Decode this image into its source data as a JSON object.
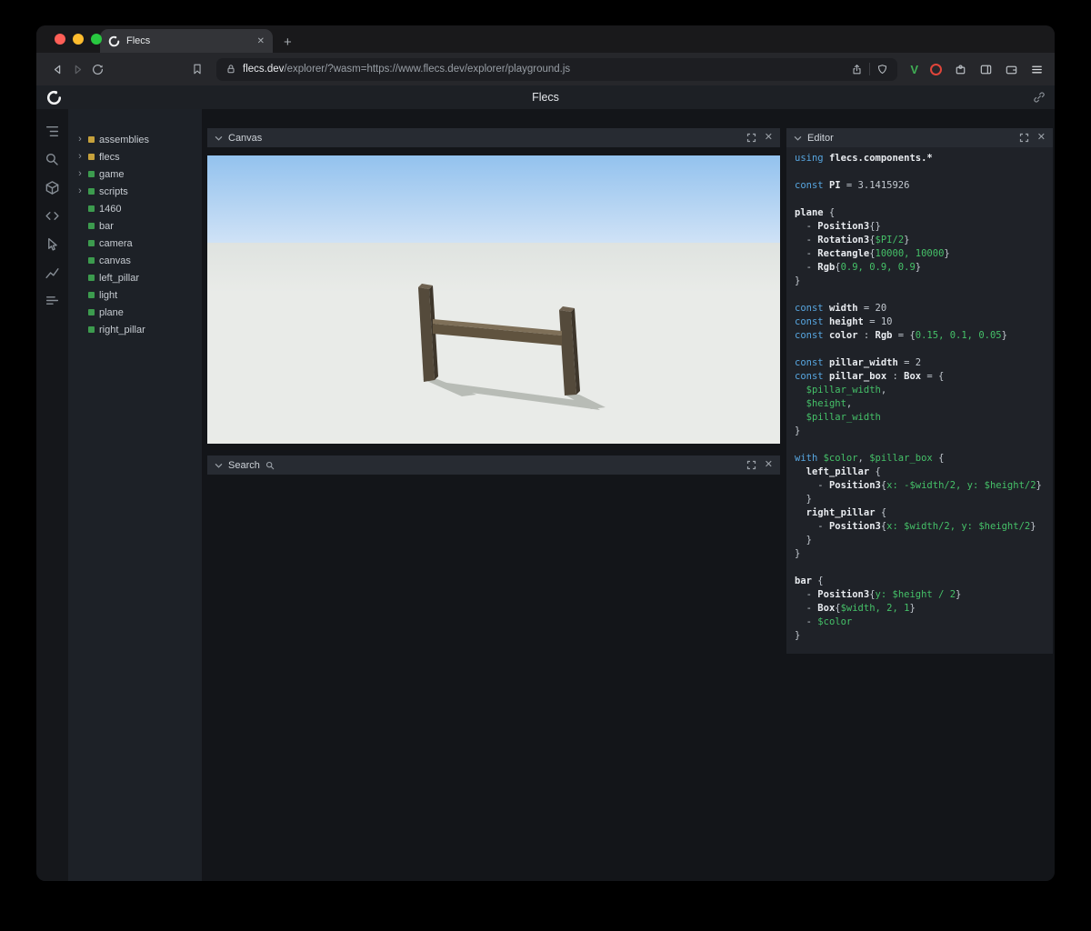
{
  "glyphs": {
    "close": "✕",
    "plus": "+",
    "expander": "›"
  },
  "browser": {
    "tab_title": "Flecs",
    "url_domain": "flecs.dev",
    "url_path": "/explorer/?wasm=https://www.flecs.dev/explorer/playground.js"
  },
  "header": {
    "title": "Flecs"
  },
  "rail_icons": [
    "tree-icon",
    "search-icon",
    "cube-icon",
    "code-icon",
    "inspect-icon",
    "chart-icon",
    "stats-icon"
  ],
  "tree": {
    "items": [
      {
        "label": "assemblies",
        "color": "#c6a13c",
        "expandable": true
      },
      {
        "label": "flecs",
        "color": "#c6a13c",
        "expandable": true
      },
      {
        "label": "game",
        "color": "#3c9b4e",
        "expandable": true
      },
      {
        "label": "scripts",
        "color": "#3c9b4e",
        "expandable": true
      },
      {
        "label": "1460",
        "color": "#3c9b4e",
        "expandable": false
      },
      {
        "label": "bar",
        "color": "#3c9b4e",
        "expandable": false
      },
      {
        "label": "camera",
        "color": "#3c9b4e",
        "expandable": false
      },
      {
        "label": "canvas",
        "color": "#3c9b4e",
        "expandable": false
      },
      {
        "label": "left_pillar",
        "color": "#3c9b4e",
        "expandable": false
      },
      {
        "label": "light",
        "color": "#3c9b4e",
        "expandable": false
      },
      {
        "label": "plane",
        "color": "#3c9b4e",
        "expandable": false
      },
      {
        "label": "right_pillar",
        "color": "#3c9b4e",
        "expandable": false
      }
    ]
  },
  "panels": {
    "canvas": {
      "title": "Canvas"
    },
    "search": {
      "title": "Search"
    },
    "editor": {
      "title": "Editor"
    }
  },
  "editor_code": {
    "lines": [
      [
        {
          "t": "using ",
          "c": "kw"
        },
        {
          "t": "flecs.components.*",
          "c": "id"
        }
      ],
      [],
      [
        {
          "t": "const ",
          "c": "kw"
        },
        {
          "t": "PI",
          "c": "id"
        },
        {
          "t": " = 3.1415926",
          "c": "pl"
        }
      ],
      [],
      [
        {
          "t": "plane",
          "c": "id"
        },
        {
          "t": " {",
          "c": "pl"
        }
      ],
      [
        {
          "t": "  - ",
          "c": "pl"
        },
        {
          "t": "Position3",
          "c": "id"
        },
        {
          "t": "{}",
          "c": "pl"
        }
      ],
      [
        {
          "t": "  - ",
          "c": "pl"
        },
        {
          "t": "Rotation3",
          "c": "id"
        },
        {
          "t": "{",
          "c": "pl"
        },
        {
          "t": "$PI/2",
          "c": "gr"
        },
        {
          "t": "}",
          "c": "pl"
        }
      ],
      [
        {
          "t": "  - ",
          "c": "pl"
        },
        {
          "t": "Rectangle",
          "c": "id"
        },
        {
          "t": "{",
          "c": "pl"
        },
        {
          "t": "10000, 10000",
          "c": "gr"
        },
        {
          "t": "}",
          "c": "pl"
        }
      ],
      [
        {
          "t": "  - ",
          "c": "pl"
        },
        {
          "t": "Rgb",
          "c": "id"
        },
        {
          "t": "{",
          "c": "pl"
        },
        {
          "t": "0.9, 0.9, 0.9",
          "c": "gr"
        },
        {
          "t": "}",
          "c": "pl"
        }
      ],
      [
        {
          "t": "}",
          "c": "pl"
        }
      ],
      [],
      [
        {
          "t": "const ",
          "c": "kw"
        },
        {
          "t": "width",
          "c": "id"
        },
        {
          "t": " = 20",
          "c": "pl"
        }
      ],
      [
        {
          "t": "const ",
          "c": "kw"
        },
        {
          "t": "height",
          "c": "id"
        },
        {
          "t": " = 10",
          "c": "pl"
        }
      ],
      [
        {
          "t": "const ",
          "c": "kw"
        },
        {
          "t": "color",
          "c": "id"
        },
        {
          "t": " : ",
          "c": "pl"
        },
        {
          "t": "Rgb",
          "c": "id"
        },
        {
          "t": " = {",
          "c": "pl"
        },
        {
          "t": "0.15, 0.1, 0.05",
          "c": "gr"
        },
        {
          "t": "}",
          "c": "pl"
        }
      ],
      [],
      [
        {
          "t": "const ",
          "c": "kw"
        },
        {
          "t": "pillar_width",
          "c": "id"
        },
        {
          "t": " = 2",
          "c": "pl"
        }
      ],
      [
        {
          "t": "const ",
          "c": "kw"
        },
        {
          "t": "pillar_box",
          "c": "id"
        },
        {
          "t": " : ",
          "c": "pl"
        },
        {
          "t": "Box",
          "c": "id"
        },
        {
          "t": " = {",
          "c": "pl"
        }
      ],
      [
        {
          "t": "  ",
          "c": "pl"
        },
        {
          "t": "$pillar_width",
          "c": "gr"
        },
        {
          "t": ",",
          "c": "pl"
        }
      ],
      [
        {
          "t": "  ",
          "c": "pl"
        },
        {
          "t": "$height",
          "c": "gr"
        },
        {
          "t": ",",
          "c": "pl"
        }
      ],
      [
        {
          "t": "  ",
          "c": "pl"
        },
        {
          "t": "$pillar_width",
          "c": "gr"
        }
      ],
      [
        {
          "t": "}",
          "c": "pl"
        }
      ],
      [],
      [
        {
          "t": "with ",
          "c": "kw"
        },
        {
          "t": "$color",
          "c": "gr"
        },
        {
          "t": ", ",
          "c": "pl"
        },
        {
          "t": "$pillar_box",
          "c": "gr"
        },
        {
          "t": " {",
          "c": "pl"
        }
      ],
      [
        {
          "t": "  ",
          "c": "pl"
        },
        {
          "t": "left_pillar",
          "c": "id"
        },
        {
          "t": " {",
          "c": "pl"
        }
      ],
      [
        {
          "t": "    - ",
          "c": "pl"
        },
        {
          "t": "Position3",
          "c": "id"
        },
        {
          "t": "{",
          "c": "pl"
        },
        {
          "t": "x: -$width/2, y: $height/2",
          "c": "gr"
        },
        {
          "t": "}",
          "c": "pl"
        }
      ],
      [
        {
          "t": "  }",
          "c": "pl"
        }
      ],
      [
        {
          "t": "  ",
          "c": "pl"
        },
        {
          "t": "right_pillar",
          "c": "id"
        },
        {
          "t": " {",
          "c": "pl"
        }
      ],
      [
        {
          "t": "    - ",
          "c": "pl"
        },
        {
          "t": "Position3",
          "c": "id"
        },
        {
          "t": "{",
          "c": "pl"
        },
        {
          "t": "x: $width/2, y: $height/2",
          "c": "gr"
        },
        {
          "t": "}",
          "c": "pl"
        }
      ],
      [
        {
          "t": "  }",
          "c": "pl"
        }
      ],
      [
        {
          "t": "}",
          "c": "pl"
        }
      ],
      [],
      [
        {
          "t": "bar",
          "c": "id"
        },
        {
          "t": " {",
          "c": "pl"
        }
      ],
      [
        {
          "t": "  - ",
          "c": "pl"
        },
        {
          "t": "Position3",
          "c": "id"
        },
        {
          "t": "{",
          "c": "pl"
        },
        {
          "t": "y: $height / 2",
          "c": "gr"
        },
        {
          "t": "}",
          "c": "pl"
        }
      ],
      [
        {
          "t": "  - ",
          "c": "pl"
        },
        {
          "t": "Box",
          "c": "id"
        },
        {
          "t": "{",
          "c": "pl"
        },
        {
          "t": "$width, 2, 1",
          "c": "gr"
        },
        {
          "t": "}",
          "c": "pl"
        }
      ],
      [
        {
          "t": "  - ",
          "c": "pl"
        },
        {
          "t": "$color",
          "c": "gr"
        }
      ],
      [
        {
          "t": "}",
          "c": "pl"
        }
      ]
    ]
  },
  "colors": {
    "code_keyword": "#57a6e0",
    "code_value": "#45c068",
    "accent_v": "#3fae54",
    "traffic_red": "#ff5f57",
    "traffic_yellow": "#febc2e",
    "traffic_green": "#28c840",
    "sky_top": "#93c2ee",
    "sky_horizon": "#cfe2f6",
    "ground": "#e9ebe8",
    "pillar": "#544a3b",
    "bar": "#60533f",
    "shadow": "#b0b4ae"
  }
}
